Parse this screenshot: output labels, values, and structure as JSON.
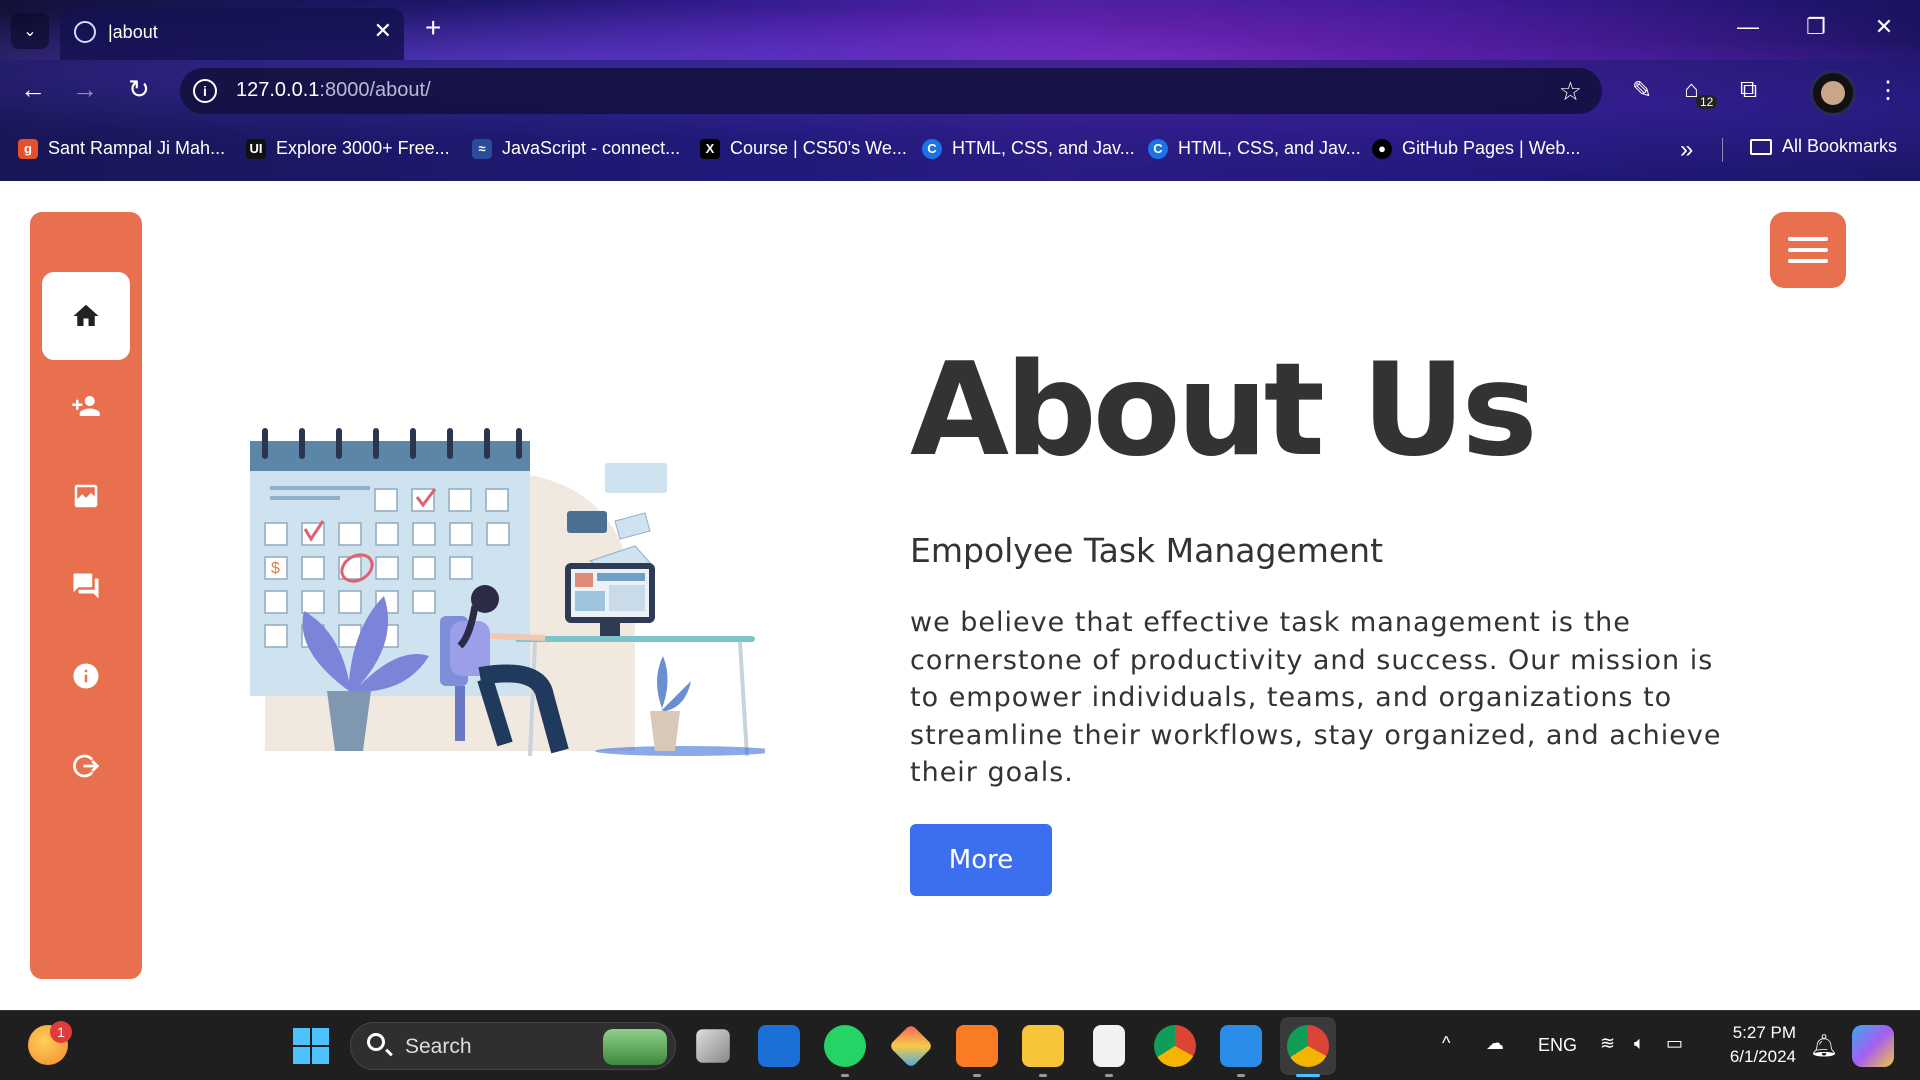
{
  "browser": {
    "tab_title": "|about",
    "tab_close": "✕",
    "new_tab": "+",
    "url_host": "127.0.0.1",
    "url_path": ":8000/about/",
    "extension_badge": "12",
    "bookmarks": [
      "Sant Rampal Ji Mah...",
      "Explore 3000+ Free...",
      "JavaScript - connect...",
      "Course | CS50's We...",
      "HTML, CSS, and Jav...",
      "HTML, CSS, and Jav...",
      "GitHub Pages | Web..."
    ],
    "bookmark_favicons": [
      "g",
      "UI",
      "≈",
      "X",
      "C",
      "C",
      "●"
    ],
    "all_bookmarks": "All Bookmarks",
    "more_bookmarks": "»"
  },
  "sidebar": {
    "items": [
      "home-icon",
      "add-person-icon",
      "chart-icon",
      "chat-icon",
      "info-icon",
      "logout-icon"
    ],
    "active_index": 0
  },
  "main": {
    "title": "About Us",
    "subtitle": "Empolyee Task Management",
    "description": "we believe that effective task management is the cornerstone of productivity and success. Our mission is to empower individuals, teams, and organizations to streamline their workflows, stay organized, and achieve their goals.",
    "more_button": "More"
  },
  "taskbar": {
    "search_label": "Search",
    "notification_count": "1",
    "language": "ENG",
    "time": "5:27 PM",
    "date": "6/1/2024"
  },
  "colors": {
    "accent": "#e8704f",
    "button_blue": "#3b6ff0",
    "text_dark": "#333333"
  }
}
